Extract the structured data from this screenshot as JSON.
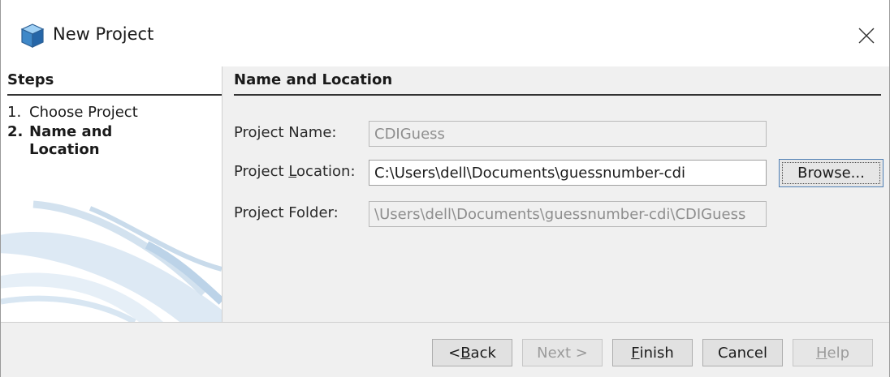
{
  "window": {
    "title": "New Project",
    "close_icon": "close-icon",
    "app_icon": "cube-icon"
  },
  "steps": {
    "title": "Steps",
    "items": [
      {
        "number": "1.",
        "label": "Choose Project",
        "current": false
      },
      {
        "number": "2.",
        "label": "Name and Location",
        "current": true
      }
    ]
  },
  "section": {
    "title": "Name and Location"
  },
  "fields": {
    "project_name": {
      "label": "Project Name:",
      "value": "CDIGuess",
      "editable": false
    },
    "project_location": {
      "label_pre": "Project ",
      "label_mnemonic": "L",
      "label_post": "ocation:",
      "value": "C:\\Users\\dell\\Documents\\guessnumber-cdi",
      "editable": true
    },
    "project_folder": {
      "label": "Project Folder:",
      "value": "\\Users\\dell\\Documents\\guessnumber-cdi\\CDIGuess",
      "editable": false
    }
  },
  "browse_button": {
    "label": "Browse..."
  },
  "buttons": {
    "back": {
      "pre": "< ",
      "mnemonic": "B",
      "post": "ack",
      "enabled": true
    },
    "next": {
      "label": "Next >",
      "enabled": false
    },
    "finish": {
      "mnemonic": "F",
      "post": "inish",
      "enabled": true
    },
    "cancel": {
      "label": "Cancel",
      "enabled": true
    },
    "help": {
      "mnemonic": "H",
      "post": "elp",
      "enabled": false
    }
  },
  "colors": {
    "dialog_bg": "#f0f0f0",
    "panel_bg": "#ffffff",
    "focus_border": "#4f7fb5",
    "disabled_text": "#9b9b9b"
  }
}
